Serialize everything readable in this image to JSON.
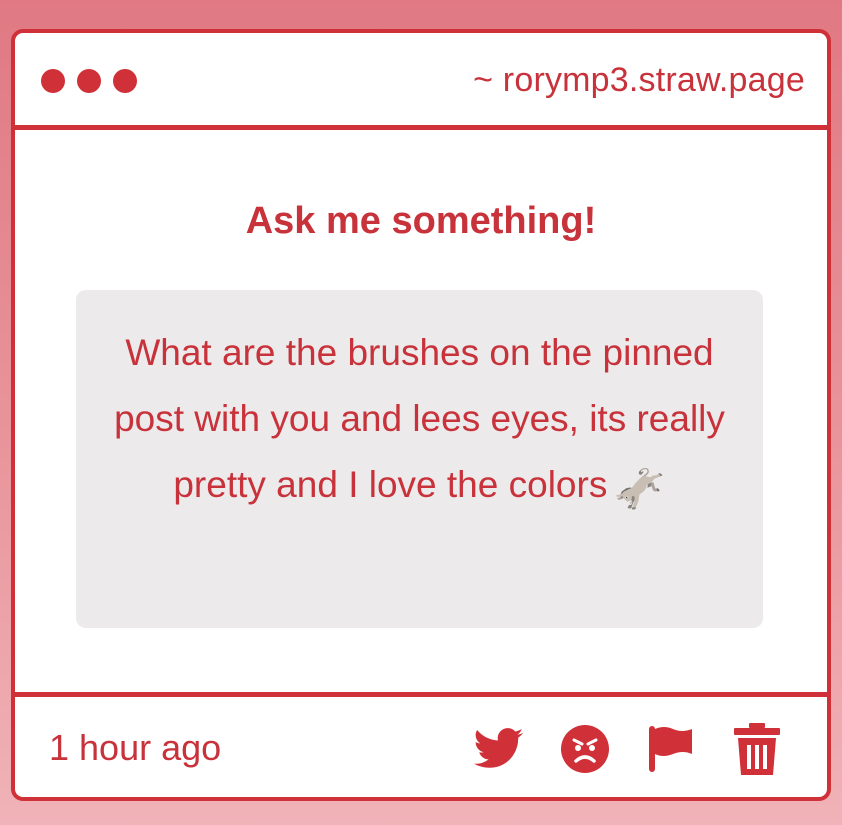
{
  "window": {
    "url": "~ rorymp3.straw.page"
  },
  "content": {
    "heading": "Ask me something!",
    "question": "What are the brushes on the pinned post with you and lees eyes, its really pretty and I love the colors",
    "question_emoji": "🫏"
  },
  "footer": {
    "timestamp": "1 hour ago",
    "actions": [
      {
        "icon": "twitter-icon"
      },
      {
        "icon": "angry-face-icon"
      },
      {
        "icon": "flag-icon"
      },
      {
        "icon": "trash-icon"
      }
    ]
  },
  "colors": {
    "accent": "#d03038",
    "text": "#c8323a",
    "question_bg": "#eceaeb",
    "background_top": "#e07983",
    "background_bottom": "#f0b3b8"
  }
}
